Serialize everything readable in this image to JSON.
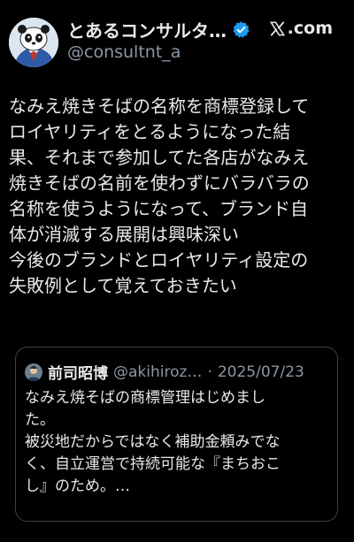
{
  "author": {
    "display_name": "とあるコンサルタ…",
    "handle": "@consultnt_a",
    "verified": true,
    "avatar_icon": "panda-avatar-icon"
  },
  "brand": {
    "logo_icon": "x-logo-icon",
    "label": ".com"
  },
  "post": {
    "lines": [
      "なみえ焼きそばの名称を商標登録して",
      "ロイヤリティをとるようになった結",
      "果、それまで参加してた各店がなみえ",
      "焼きそばの名前を使わずにバラバラの",
      "名称を使うようになって、ブランド自",
      "体が消滅する展開は興味深い",
      "今後のブランドとロイヤリティ設定の",
      "失敗例として覚えておきたい"
    ]
  },
  "quoted_post": {
    "name": "前司昭博",
    "handle": "@akihiroz…",
    "separator": "·",
    "date": "2025/07/23",
    "lines": [
      "なみえ焼そばの商標管理はじめまし",
      "た。",
      "被災地だからではなく補助金頼みでな",
      "く、自立運営で持続可能な『まちおこ",
      "し』のため。…"
    ]
  },
  "colors": {
    "background": "#000000",
    "text": "#e7e9ea",
    "secondary_text": "#8b98a5",
    "verified_badge": "#1d9bf0",
    "border": "#38444d"
  }
}
